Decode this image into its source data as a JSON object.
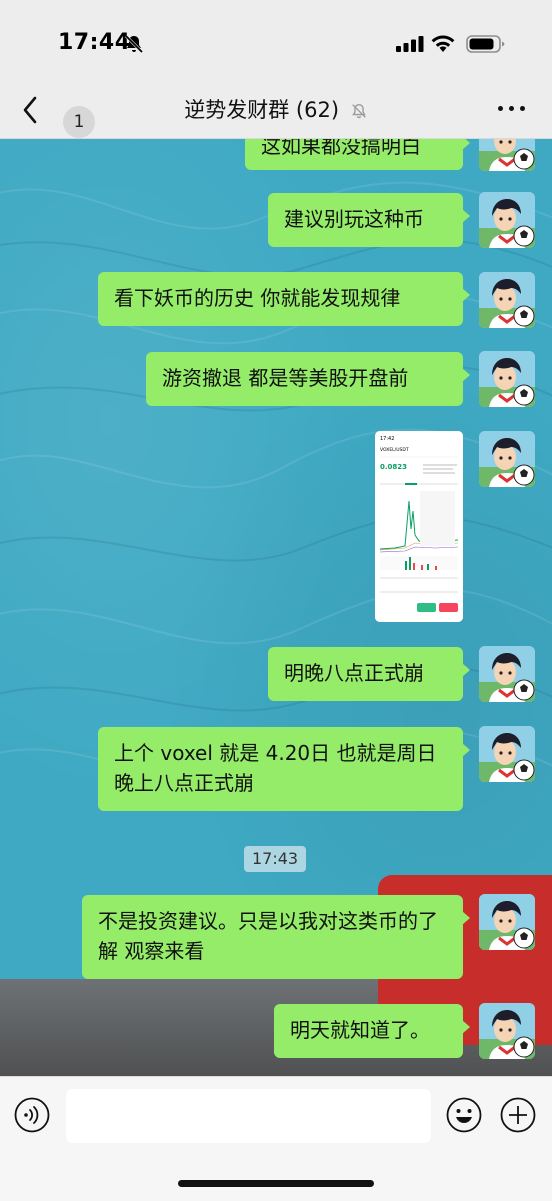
{
  "status_bar": {
    "time": "17:44",
    "icons": [
      "bell-off-icon",
      "cellular-signal-icon",
      "wifi-icon",
      "battery-icon"
    ]
  },
  "nav": {
    "back_badge": "1",
    "title": "逆势发财群 (62)",
    "icons": [
      "back-chevron-icon",
      "mute-bell-icon",
      "more-icon"
    ]
  },
  "messages": [
    {
      "type": "text",
      "text": "这如果都没搞明白",
      "from": "self"
    },
    {
      "type": "text",
      "text": "建议别玩这种币",
      "from": "self"
    },
    {
      "type": "text",
      "text": "看下妖币的历史 你就能发现规律",
      "from": "self"
    },
    {
      "type": "text",
      "text": "游资撤退 都是等美股开盘前",
      "from": "self"
    },
    {
      "type": "image",
      "from": "self",
      "image": {
        "status_time": "17:42",
        "pair": "VOXEL/USDT",
        "price": "0.0823"
      }
    },
    {
      "type": "text",
      "text": "明晚八点正式崩",
      "from": "self"
    },
    {
      "type": "text",
      "text": "上个 voxel 就是 4.20日 也就是周日 晚上八点正式崩",
      "from": "self"
    },
    {
      "type": "time",
      "text": "17:43"
    },
    {
      "type": "text",
      "text": "不是投资建议。只是以我对这类币的了解 观察来看",
      "from": "self"
    },
    {
      "type": "text",
      "text": "明天就知道了。",
      "from": "self"
    }
  ],
  "input": {
    "value": "",
    "placeholder": ""
  },
  "colors": {
    "bubble": "#95ec69",
    "chat_bg": "#3fa9c3",
    "bar": "#ededed"
  }
}
